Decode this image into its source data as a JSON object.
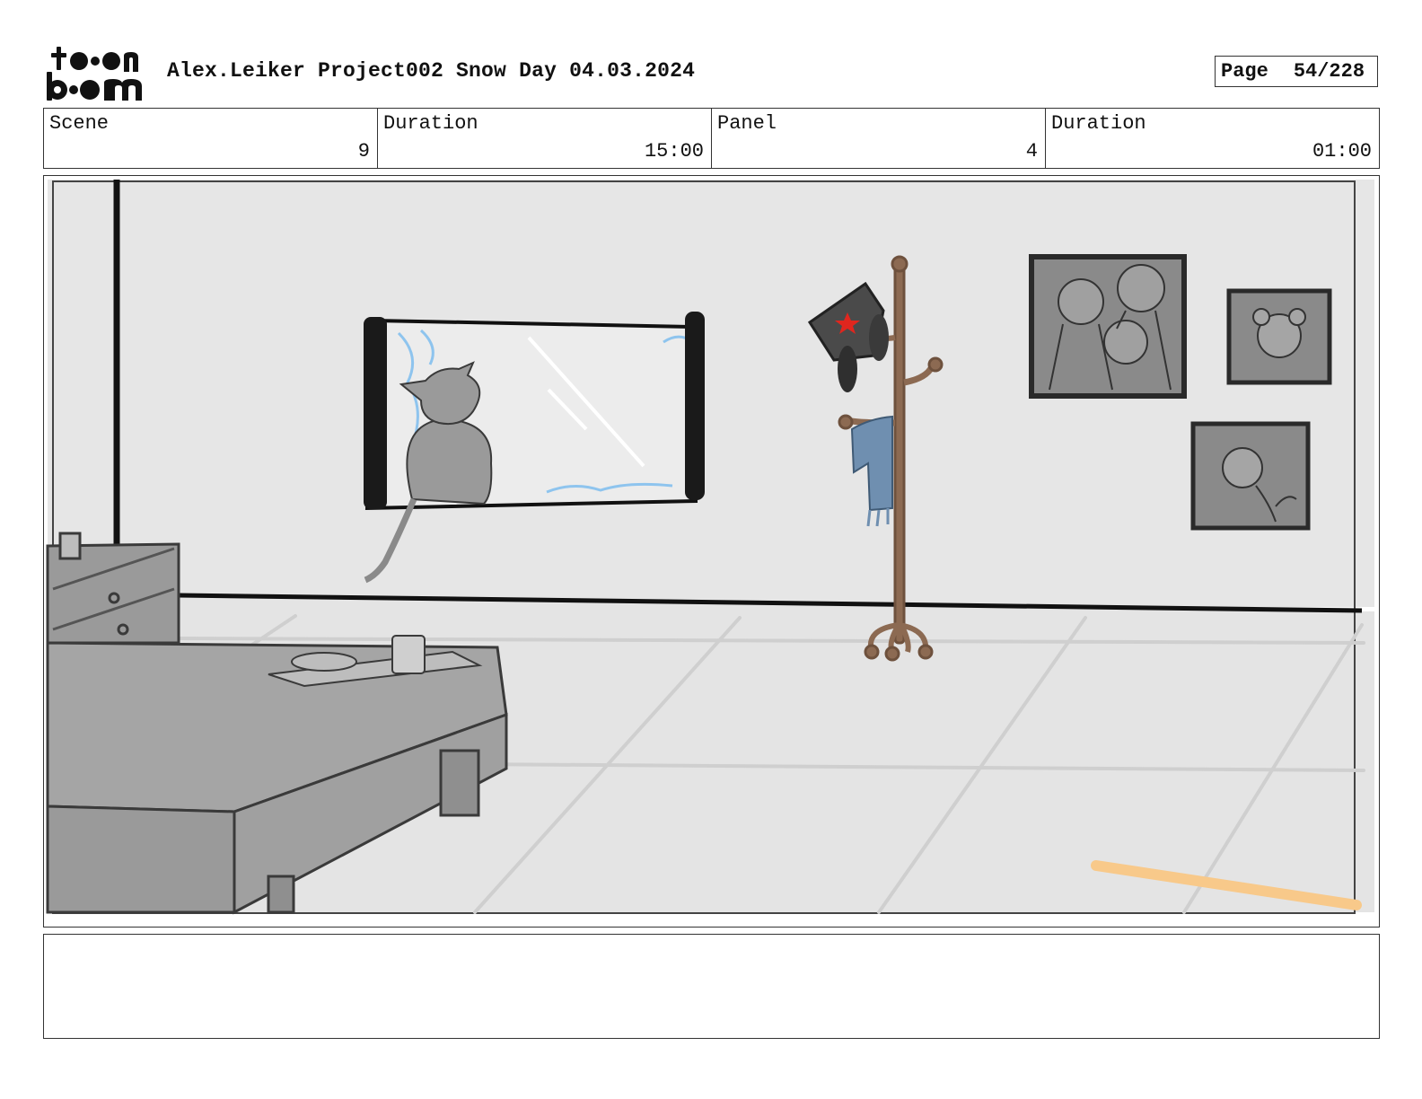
{
  "header": {
    "logo_text": "toonboom",
    "project_title": "Alex.Leiker Project002 Snow Day 04.03.2024",
    "page_label": "Page",
    "page_value": "54/228"
  },
  "info": {
    "scene_label": "Scene",
    "scene_value": "9",
    "scene_duration_label": "Duration",
    "scene_duration_value": "15:00",
    "panel_label": "Panel",
    "panel_value": "4",
    "panel_duration_label": "Duration",
    "panel_duration_value": "01:00"
  },
  "panel": {
    "colors": {
      "wall": "#e6e6e6",
      "floor": "#e4e4e4",
      "furniture": "#a5a5a5",
      "coat_rack": "#8c6a52",
      "scarf": "#6f8fb0",
      "frost": "#8ec4ee",
      "sun_streak": "#f8c98a",
      "hat_star": "#e0261e"
    }
  },
  "notes": {
    "text": ""
  }
}
